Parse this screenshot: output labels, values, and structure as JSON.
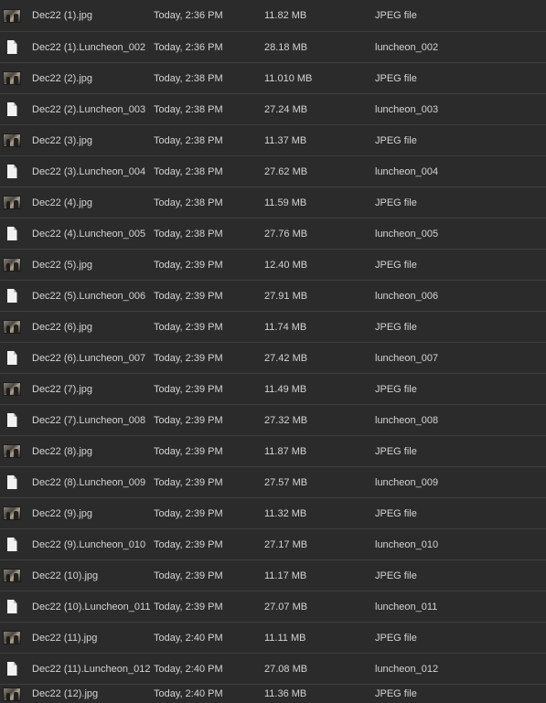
{
  "files": [
    {
      "icon": "jpeg-thumbnail-icon",
      "name": "Dec22 (1).jpg",
      "date": "Today, 2:36 PM",
      "size": "11.82 MB",
      "kind": "JPEG file"
    },
    {
      "icon": "document-icon",
      "name": "Dec22 (1).Luncheon_002",
      "date": "Today, 2:36 PM",
      "size": "28.18 MB",
      "kind": "luncheon_002"
    },
    {
      "icon": "jpeg-thumbnail-icon",
      "name": "Dec22 (2).jpg",
      "date": "Today, 2:38 PM",
      "size": "11.010 MB",
      "kind": "JPEG file"
    },
    {
      "icon": "document-icon",
      "name": "Dec22 (2).Luncheon_003",
      "date": "Today, 2:38 PM",
      "size": "27.24 MB",
      "kind": "luncheon_003"
    },
    {
      "icon": "jpeg-thumbnail-icon",
      "name": "Dec22 (3).jpg",
      "date": "Today, 2:38 PM",
      "size": "11.37 MB",
      "kind": "JPEG file"
    },
    {
      "icon": "document-icon",
      "name": "Dec22 (3).Luncheon_004",
      "date": "Today, 2:38 PM",
      "size": "27.62 MB",
      "kind": "luncheon_004"
    },
    {
      "icon": "jpeg-thumbnail-icon",
      "name": "Dec22 (4).jpg",
      "date": "Today, 2:38 PM",
      "size": "11.59 MB",
      "kind": "JPEG file"
    },
    {
      "icon": "document-icon",
      "name": "Dec22 (4).Luncheon_005",
      "date": "Today, 2:38 PM",
      "size": "27.76 MB",
      "kind": "luncheon_005"
    },
    {
      "icon": "jpeg-thumbnail-icon",
      "name": "Dec22 (5).jpg",
      "date": "Today, 2:39 PM",
      "size": "12.40 MB",
      "kind": "JPEG file"
    },
    {
      "icon": "document-icon",
      "name": "Dec22 (5).Luncheon_006",
      "date": "Today, 2:39 PM",
      "size": "27.91 MB",
      "kind": "luncheon_006"
    },
    {
      "icon": "jpeg-thumbnail-icon",
      "name": "Dec22 (6).jpg",
      "date": "Today, 2:39 PM",
      "size": "11.74 MB",
      "kind": "JPEG file"
    },
    {
      "icon": "document-icon",
      "name": "Dec22 (6).Luncheon_007",
      "date": "Today, 2:39 PM",
      "size": "27.42 MB",
      "kind": "luncheon_007"
    },
    {
      "icon": "jpeg-thumbnail-icon",
      "name": "Dec22 (7).jpg",
      "date": "Today, 2:39 PM",
      "size": "11.49 MB",
      "kind": "JPEG file"
    },
    {
      "icon": "document-icon",
      "name": "Dec22 (7).Luncheon_008",
      "date": "Today, 2:39 PM",
      "size": "27.32 MB",
      "kind": "luncheon_008"
    },
    {
      "icon": "jpeg-thumbnail-icon",
      "name": "Dec22 (8).jpg",
      "date": "Today, 2:39 PM",
      "size": "11.87 MB",
      "kind": "JPEG file"
    },
    {
      "icon": "document-icon",
      "name": "Dec22 (8).Luncheon_009",
      "date": "Today, 2:39 PM",
      "size": "27.57 MB",
      "kind": "luncheon_009"
    },
    {
      "icon": "jpeg-thumbnail-icon",
      "name": "Dec22 (9).jpg",
      "date": "Today, 2:39 PM",
      "size": "11.32 MB",
      "kind": "JPEG file"
    },
    {
      "icon": "document-icon",
      "name": "Dec22 (9).Luncheon_010",
      "date": "Today, 2:39 PM",
      "size": "27.17 MB",
      "kind": "luncheon_010"
    },
    {
      "icon": "jpeg-thumbnail-icon",
      "name": "Dec22 (10).jpg",
      "date": "Today, 2:39 PM",
      "size": "11.17 MB",
      "kind": "JPEG file"
    },
    {
      "icon": "document-icon",
      "name": "Dec22 (10).Luncheon_011",
      "date": "Today, 2:39 PM",
      "size": "27.07 MB",
      "kind": "luncheon_011"
    },
    {
      "icon": "jpeg-thumbnail-icon",
      "name": "Dec22 (11).jpg",
      "date": "Today, 2:40 PM",
      "size": "11.11 MB",
      "kind": "JPEG file"
    },
    {
      "icon": "document-icon",
      "name": "Dec22 (11).Luncheon_012",
      "date": "Today, 2:40 PM",
      "size": "27.08 MB",
      "kind": "luncheon_012"
    },
    {
      "icon": "jpeg-thumbnail-icon",
      "name": "Dec22 (12).jpg",
      "date": "Today, 2:40 PM",
      "size": "11.36 MB",
      "kind": "JPEG file"
    }
  ]
}
